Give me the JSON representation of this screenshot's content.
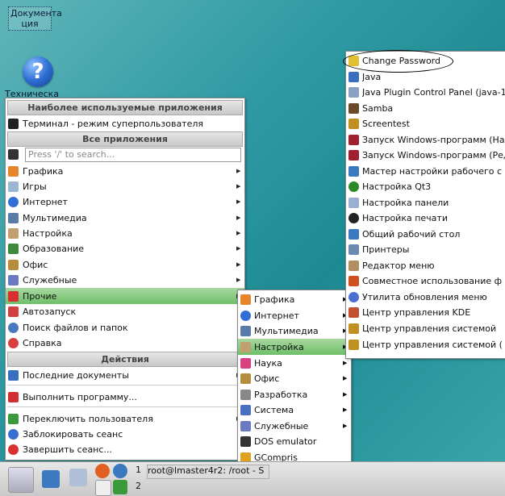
{
  "desktop": {
    "doc_label": "Документа ция",
    "tech_label": "Техническа"
  },
  "main_menu": {
    "header_frequent": "Наиболее используемые приложения",
    "terminal": "Терминал - режим суперпользователя",
    "header_all": "Все приложения",
    "search_placeholder": "Press '/' to search...",
    "items": [
      "Графика",
      "Игры",
      "Интернет",
      "Мультимедиа",
      "Настройка",
      "Образование",
      "Офис",
      "Служебные",
      "Прочие",
      "Автозапуск",
      "Поиск файлов и папок",
      "Справка"
    ],
    "header_actions": "Действия",
    "actions": [
      "Последние документы",
      "Выполнить программу...",
      "Переключить пользователя",
      "Заблокировать сеанс",
      "Завершить сеанс..."
    ]
  },
  "submenu_other": {
    "items": [
      "Графика",
      "Интернет",
      "Мультимедиа",
      "Настройка",
      "Наука",
      "Офис",
      "Разработка",
      "Система",
      "Служебные",
      "DOS emulator",
      "GCompris"
    ]
  },
  "submenu_settings": {
    "items": [
      "Change Password",
      "Java",
      "Java Plugin Control Panel (java-1",
      "Samba",
      "Screentest",
      "Запуск Windows-программ (Нас",
      "Запуск Windows-программ (Ред",
      "Мастер настройки рабочего с",
      "Настройка Qt3",
      "Настройка панели",
      "Настройка печати",
      "Общий рабочий стол",
      "Принтеры",
      "Редактор меню",
      "Совместное использование ф",
      "Утилита обновления меню",
      "Центр управления KDE",
      "Центр управления системой",
      "Центр управления системой ("
    ]
  },
  "taskbar": {
    "desktop1": "1",
    "desktop2": "2",
    "task": "root@lmaster4r2: /root - S"
  }
}
